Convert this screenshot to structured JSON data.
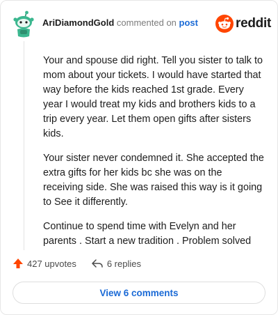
{
  "comment": {
    "author": "AriDiamondGold",
    "action_text": "commented on",
    "post_link_text": "post",
    "paragraphs": [
      "Your and spouse did right. Tell you sister to talk to mom about your tickets. I would have started that way before the kids reached 1st grade. Every year I would treat my kids and brothers kids to a trip every year. Let them open gifts after sisters kids.",
      "Your sister never condemned it. She accepted the extra gifts for her kids bc she was on the receiving side. She was raised this way is it going to See it differently.",
      "Continue to spend time with Evelyn and her parents . Start a new tradition . Problem solved"
    ]
  },
  "logo": {
    "text": "reddit",
    "brand_color": "#ff4500"
  },
  "actions": {
    "upvotes_label": "427 upvotes",
    "replies_label": "6 replies",
    "upvote_color": "#ff4500"
  },
  "view_comments_label": "View 6 comments",
  "icons": {
    "avatar": "snoo-avatar-icon",
    "logo": "reddit-alien-icon",
    "upvote": "upvote-arrow-icon",
    "reply": "reply-arrow-icon"
  },
  "colors": {
    "link": "#1a6ad6",
    "avatar_green": "#3bb78f"
  }
}
